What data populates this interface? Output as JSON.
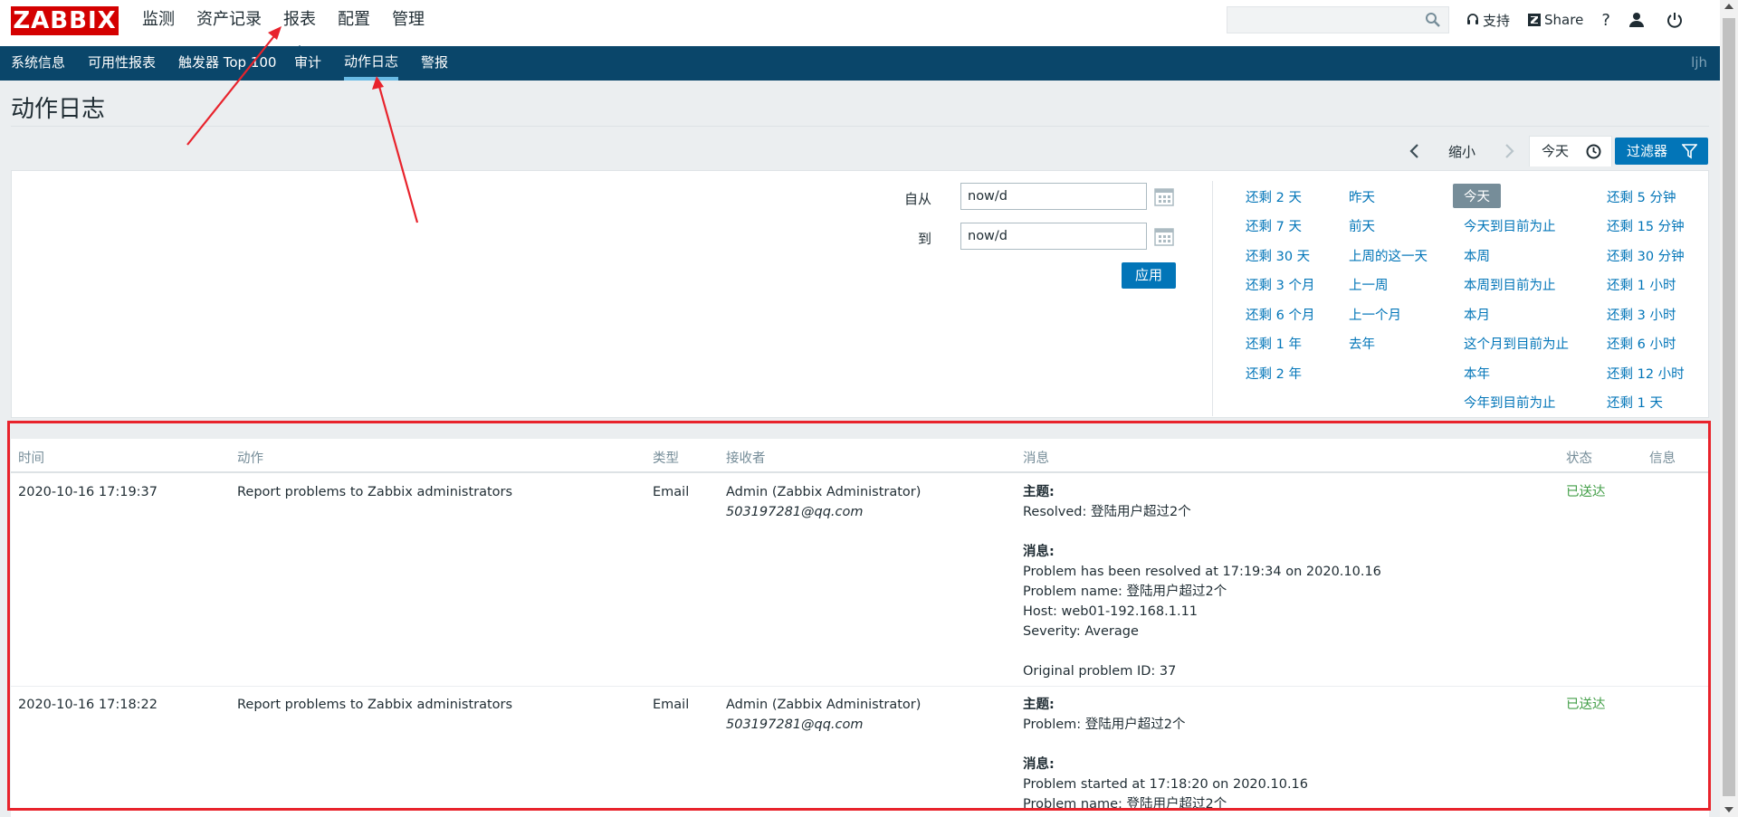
{
  "logo": "ZABBIX",
  "main_nav": [
    "监测",
    "资产记录",
    "报表",
    "配置",
    "管理"
  ],
  "main_nav_selected": 2,
  "header_tools": {
    "support": "支持",
    "share": "Share",
    "help": "?"
  },
  "sub_nav": [
    "系统信息",
    "可用性报表",
    "触发器 Top 100",
    "审计",
    "动作日志",
    "警报"
  ],
  "sub_nav_selected": 4,
  "user": "ljh",
  "page_title": "动作日志",
  "time_controls": {
    "zoom_out": "缩小",
    "today_tab": "今天",
    "filter": "过滤器"
  },
  "filter": {
    "from_label": "自从",
    "from_value": "now/d",
    "to_label": "到",
    "to_value": "now/d",
    "apply": "应用"
  },
  "quick_ranges": [
    [
      "还剩 2 天",
      "还剩 7 天",
      "还剩 30 天",
      "还剩 3 个月",
      "还剩 6 个月",
      "还剩 1 年",
      "还剩 2 年"
    ],
    [
      "昨天",
      "前天",
      "上周的这一天",
      "上一周",
      "上一个月",
      "去年"
    ],
    [
      "今天",
      "今天到目前为止",
      "本周",
      "本周到目前为止",
      "本月",
      "这个月到目前为止",
      "本年",
      "今年到目前为止"
    ],
    [
      "还剩 5 分钟",
      "还剩 15 分钟",
      "还剩 30 分钟",
      "还剩 1 小时",
      "还剩 3 小时",
      "还剩 6 小时",
      "还剩 12 小时",
      "还剩 1 天"
    ]
  ],
  "quick_range_selected": "今天",
  "table": {
    "columns": [
      "时间",
      "动作",
      "类型",
      "接收者",
      "消息",
      "状态",
      "信息"
    ],
    "rows": [
      {
        "time": "2020-10-16 17:19:37",
        "action": "Report problems to Zabbix administrators",
        "type": "Email",
        "recipient": "Admin (Zabbix Administrator)",
        "recipient_email": "503197281@qq.com",
        "subject_label": "主题:",
        "subject": "Resolved: 登陆用户超过2个",
        "message_label": "消息:",
        "message_lines": [
          "Problem has been resolved at 17:19:34 on 2020.10.16",
          "Problem name: 登陆用户超过2个",
          "Host: web01-192.168.1.11",
          "Severity: Average",
          "",
          "Original problem ID: 37"
        ],
        "status": "已送达"
      },
      {
        "time": "2020-10-16 17:18:22",
        "action": "Report problems to Zabbix administrators",
        "type": "Email",
        "recipient": "Admin (Zabbix Administrator)",
        "recipient_email": "503197281@qq.com",
        "subject_label": "主题:",
        "subject": "Problem: 登陆用户超过2个",
        "message_label": "消息:",
        "message_lines": [
          "Problem started at 17:18:20 on 2020.10.16",
          "Problem name: 登陆用户超过2个"
        ],
        "status": "已送达"
      }
    ]
  },
  "colors": {
    "brand": "#d40000",
    "nav": "#0a466a",
    "link": "#0275b8",
    "ok": "#429e47",
    "annotation": "#e8232c"
  }
}
